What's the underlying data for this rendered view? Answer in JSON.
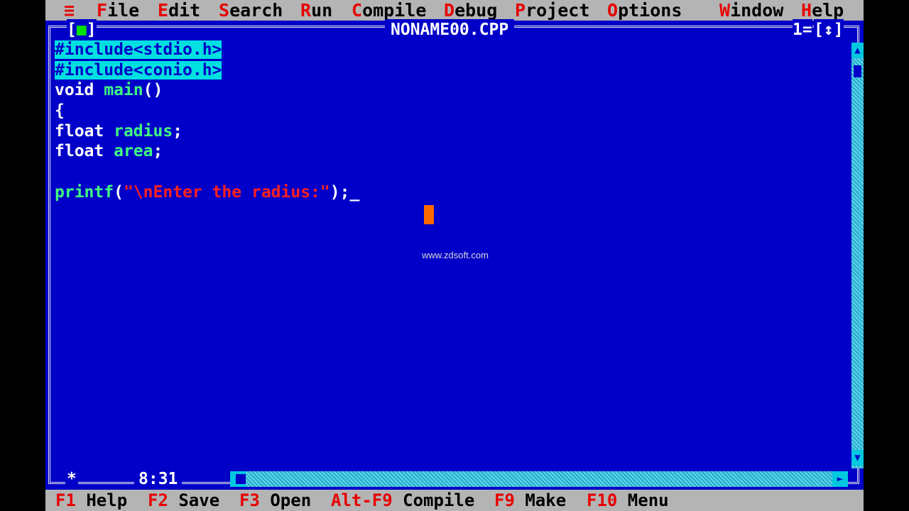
{
  "menubar": {
    "system": "≡",
    "items": [
      {
        "hot": "F",
        "rest": "ile"
      },
      {
        "hot": "E",
        "rest": "dit"
      },
      {
        "hot": "S",
        "rest": "earch"
      },
      {
        "hot": "R",
        "rest": "un"
      },
      {
        "hot": "C",
        "rest": "ompile"
      },
      {
        "hot": "D",
        "rest": "ebug"
      },
      {
        "hot": "P",
        "rest": "roject"
      },
      {
        "hot": "O",
        "rest": "ptions"
      },
      {
        "hot": "W",
        "rest": "indow"
      },
      {
        "hot": "H",
        "rest": "elp"
      }
    ]
  },
  "editor": {
    "close_box_left": "[",
    "close_box_mark": "■",
    "close_box_right": "]",
    "file_name": "NONAME00.CPP",
    "window_number": "1=",
    "zoom_box": "[↕]",
    "position": "8:31",
    "star": "*",
    "watermark": "www.zdsoft.com",
    "code": {
      "line1": "#include<stdio.h>",
      "line2": "#include<conio.h>",
      "line3_kw": "void",
      "line3_id": " main",
      "line3_p": "()",
      "line4": "{",
      "line5_kw": "float",
      "line5_id": " radius",
      "line5_p": ";",
      "line6_kw": "float",
      "line6_id": " area",
      "line6_p": ";",
      "line8_id": "printf",
      "line8_p1": "(",
      "line8_str": "\"\\nEnter the radius:\"",
      "line8_p2": ");",
      "line8_caret": "_"
    }
  },
  "statusbar": {
    "items": [
      {
        "key": "F1",
        "label": " Help"
      },
      {
        "key": "F2",
        "label": " Save"
      },
      {
        "key": "F3",
        "label": " Open"
      },
      {
        "key": "Alt-F9",
        "label": " Compile"
      },
      {
        "key": "F9",
        "label": " Make"
      },
      {
        "key": "F10",
        "label": " Menu"
      }
    ]
  },
  "colors": {
    "editor_background": "#0000c8",
    "menu_background": "#b4b4b4",
    "hotkey": "#e60000",
    "identifier": "#40ff80",
    "string": "#ff2020",
    "highlight": "#00e0e0"
  }
}
